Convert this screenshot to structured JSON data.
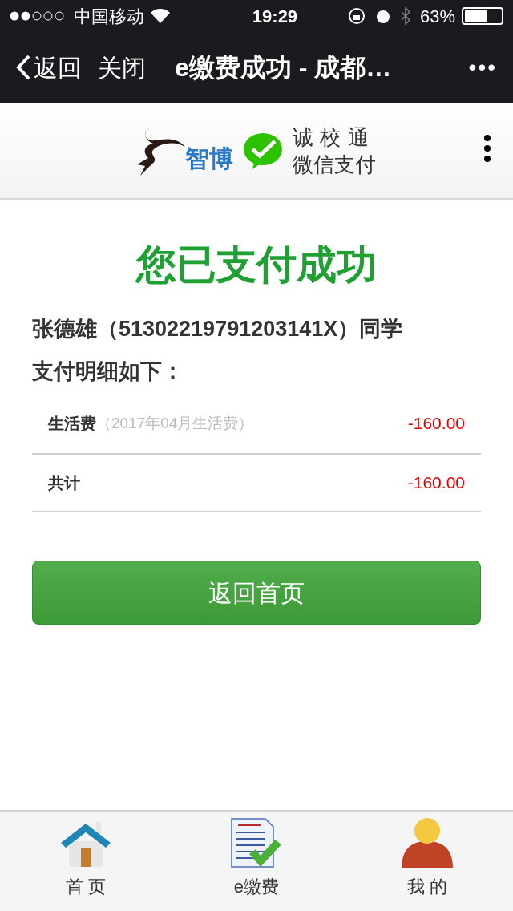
{
  "status_bar": {
    "carrier": "中国移动",
    "time": "19:29",
    "battery_text": "63%",
    "battery": {
      "level": 0.63
    }
  },
  "nav_bar": {
    "back": "返回",
    "close": "关闭",
    "title": "e缴费成功 - 成都…",
    "more": "•••"
  },
  "header": {
    "logo_text": "智博",
    "slogan_lines": [
      "诚 校 通",
      "微信支付"
    ]
  },
  "result": {
    "title": "您已支付成功",
    "student": "张德雄（51302219791203141X）同学",
    "subtitle": "支付明细如下："
  },
  "items": [
    {
      "kind": "item",
      "label": "生活费",
      "note": "（2017年04月生活费）",
      "amount": "-160.00"
    },
    {
      "kind": "total",
      "label": "共计",
      "amount": "-160.00"
    }
  ],
  "home_button": "返回首页",
  "tab_bar": [
    {
      "kind": "home",
      "label": "首 页"
    },
    {
      "kind": "pay",
      "label": "e缴费"
    },
    {
      "kind": "me",
      "label": "我 的"
    }
  ]
}
